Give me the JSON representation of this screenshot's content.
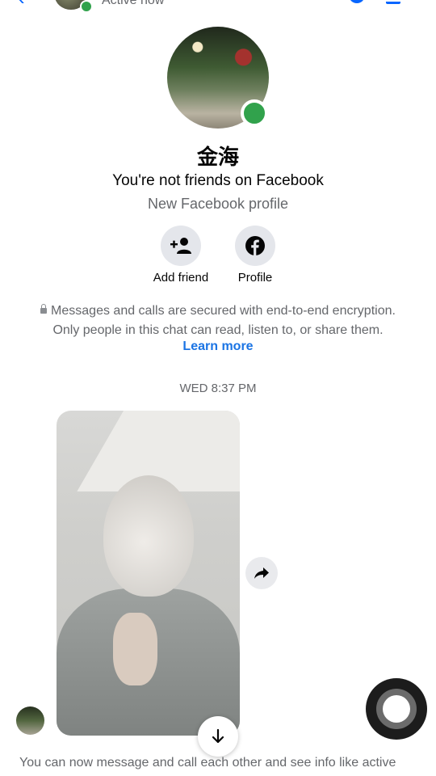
{
  "header": {
    "status": "Active now"
  },
  "profile": {
    "name": "金海",
    "relationship": "You're not friends on Facebook",
    "subtitle": "New Facebook profile"
  },
  "actions": {
    "add_friend_label": "Add friend",
    "profile_label": "Profile"
  },
  "encryption": {
    "line1": "Messages and calls are secured with end-to-end encryption.",
    "line2": "Only people in this chat can read, listen to, or share them.",
    "learn_more": "Learn more"
  },
  "conversation": {
    "timestamp": "WED 8:37 PM",
    "footer_text": "You can now message and call each other and see info like active"
  },
  "colors": {
    "accent": "#1b74e4",
    "online": "#31a24c",
    "secondary_text": "#65676b"
  },
  "icons": {
    "add_friend": "add-person-icon",
    "profile": "facebook-icon",
    "share": "share-arrow-icon",
    "scroll": "arrow-down-icon",
    "lock": "lock-icon"
  }
}
